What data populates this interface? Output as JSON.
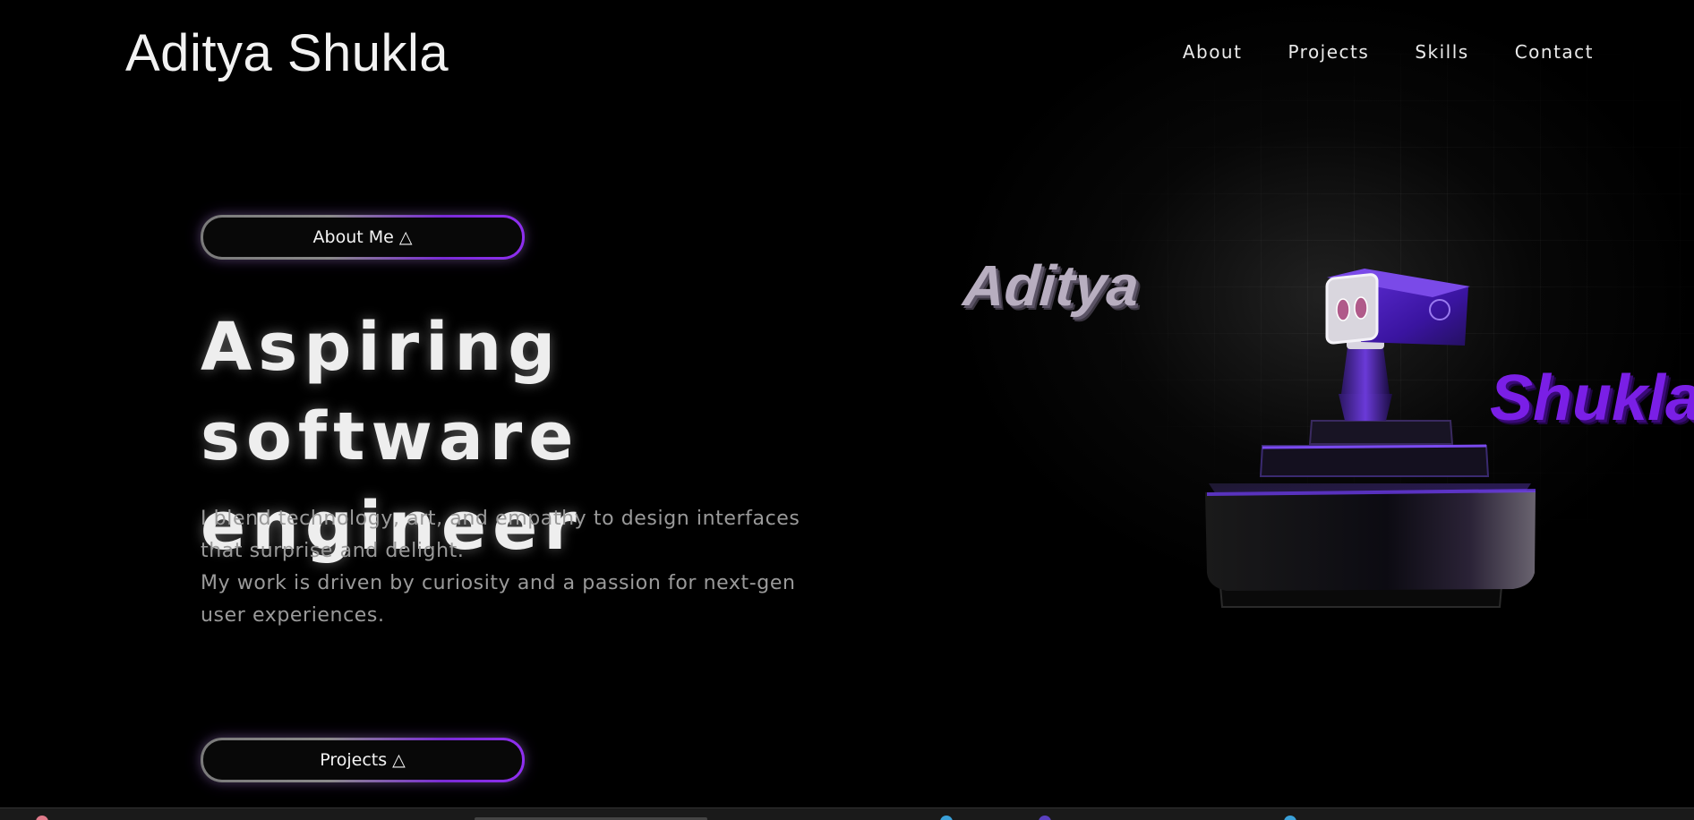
{
  "header": {
    "logo": "Aditya Shukla",
    "nav": [
      {
        "label": "About"
      },
      {
        "label": "Projects"
      },
      {
        "label": "Skills"
      },
      {
        "label": "Contact"
      }
    ]
  },
  "hero": {
    "about_button": "About Me △",
    "headline": "Aspiring software engineer",
    "intro_lines": [
      "I blend technology, art, and empathy to design interfaces that surprise and delight.",
      "My work is driven by curiosity and a passion for next-gen user experiences."
    ],
    "projects_button": "Projects △"
  },
  "scene": {
    "word_left": "Aditya",
    "word_right": "Shukla",
    "accent_color": "#7a1fe6",
    "robot": "robot-on-pedestal-3d"
  }
}
